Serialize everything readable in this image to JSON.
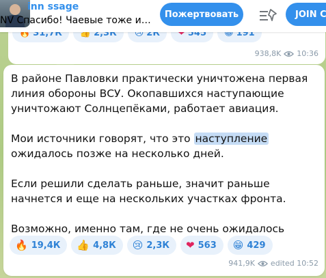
{
  "pinned": {
    "title": "inn ssage",
    "text": "NV Спасибо! Чаевые тоже ид...",
    "donate_label": "Пожертвовать",
    "join_label": "JOIN C"
  },
  "previous_message": {
    "reactions": [
      {
        "emoji": "🔥",
        "count": "31,7К"
      },
      {
        "emoji": "👍",
        "count": "2,3К"
      },
      {
        "emoji": "😢",
        "count": "2К"
      },
      {
        "emoji": "❤",
        "count": "545"
      },
      {
        "emoji": "😁",
        "count": "191"
      }
    ],
    "views": "938,8K",
    "time": "10:36"
  },
  "message": {
    "paragraphs": [
      [
        "В районе Павловки практически уничтожена первая линия обороны ВСУ. Окопавшихся наступающие уничтожают Солнцепёками, работает авиация."
      ],
      [
        "Мои источники говорят, что это ",
        "наступление",
        " ожидалось позже на несколько дней."
      ],
      [
        "Если решили сделать раньше, значит раньше начнется и еще на нескольких участках фронта."
      ],
      [
        "Возможно, именно там, где не очень ожидалось"
      ]
    ],
    "reactions": [
      {
        "emoji": "🔥",
        "count": "19,4К"
      },
      {
        "emoji": "👍",
        "count": "4,8К"
      },
      {
        "emoji": "😢",
        "count": "2,3К"
      },
      {
        "emoji": "❤",
        "count": "563"
      },
      {
        "emoji": "😁",
        "count": "429"
      }
    ],
    "views": "941,9K",
    "edited_time": "edited 10:52"
  },
  "colors": {
    "accent": "#3390ec",
    "chip_bg": "#e8f1fb",
    "chat_bg": "#b9cf8f",
    "highlight": "#c5dcf5"
  }
}
